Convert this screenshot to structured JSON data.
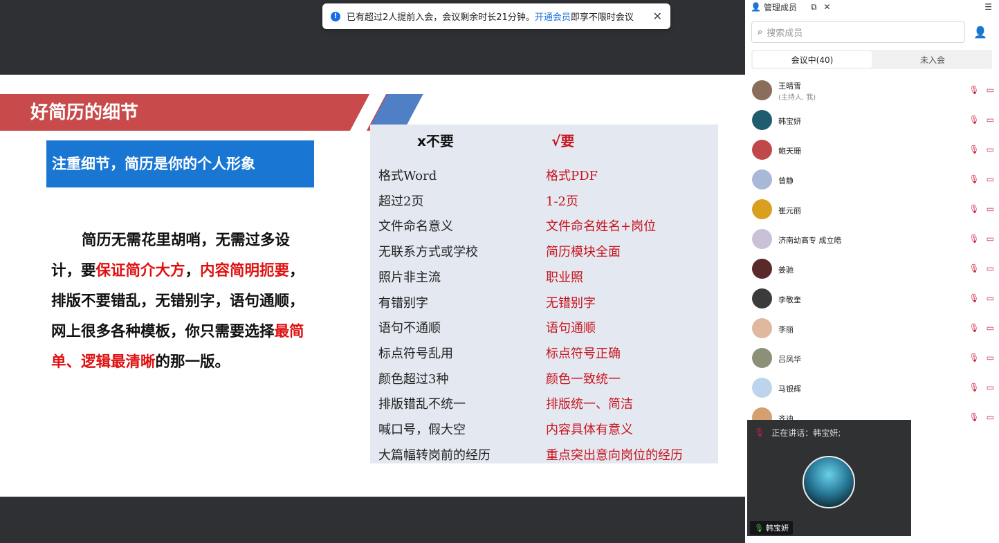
{
  "notice": {
    "text_before": "已有超过2人提前入会，会议剩余时长21分钟。",
    "link": "开通会员",
    "text_after": "即享不限时会议",
    "close": "✕"
  },
  "slide": {
    "title": "好简历的细节",
    "subtitle": "注重细节，简历是你的个人形象",
    "body": {
      "p1": "简历无需花里胡哨，无需过多设计，要",
      "r1": "保证简介大方",
      "p2": "，",
      "r2": "内容简明扼要",
      "p3": "，排版不要错乱，无错别字，语句通顺，网上很多各种模板，你只需要选择",
      "r3": "最简单、逻辑最清晰",
      "p4": "的那一版。"
    },
    "table": {
      "header_bad": "x不要",
      "header_good": "√要",
      "rows": [
        {
          "bad": "格式Word",
          "good": "格式PDF"
        },
        {
          "bad": "超过2页",
          "good": "1-2页"
        },
        {
          "bad": "文件命名意义",
          "good": "文件命名姓名+岗位"
        },
        {
          "bad": "无联系方式或学校",
          "good": "简历模块全面"
        },
        {
          "bad": "照片非主流",
          "good": "职业照"
        },
        {
          "bad": "有错别字",
          "good": "无错别字"
        },
        {
          "bad": "语句不通顺",
          "good": "语句通顺"
        },
        {
          "bad": "标点符号乱用",
          "good": "标点符号正确"
        },
        {
          "bad": "颜色超过3种",
          "good": "颜色一致统一"
        },
        {
          "bad": "排版错乱不统一",
          "good": "排版统一、简洁"
        },
        {
          "bad": "喊口号，假大空",
          "good": "内容具体有意义"
        },
        {
          "bad": "大篇幅转岗前的经历",
          "good": "重点突出意向岗位的经历"
        }
      ]
    }
  },
  "toolbar": {
    "icons": [
      "prev-icon",
      "play-icon",
      "pen-icon",
      "screenshot-icon",
      "camera-icon",
      "more-icon",
      "collapse-icon"
    ],
    "glyphs": [
      "◀",
      "▶",
      "✎",
      "⛶",
      "■",
      "⋯",
      "‹"
    ]
  },
  "panel": {
    "title": "管理成员",
    "search_placeholder": "搜索成员",
    "tab_in": "会议中(40)",
    "tab_out": "未入会",
    "members": [
      {
        "name": "王晴雪",
        "sub": "(主持人, 我)",
        "color": "#8a6d5a"
      },
      {
        "name": "韩宝妍",
        "sub": "",
        "color": "#1f5c6e"
      },
      {
        "name": "鲍天珊",
        "sub": "",
        "color": "#c04848"
      },
      {
        "name": "曾静",
        "sub": "",
        "color": "#a9b8d8"
      },
      {
        "name": "崔元丽",
        "sub": "",
        "color": "#d9a020"
      },
      {
        "name": "济南幼高专 成立皓",
        "sub": "",
        "color": "#c9c2d6"
      },
      {
        "name": "姜驰",
        "sub": "",
        "color": "#5a2a2a"
      },
      {
        "name": "李敬奎",
        "sub": "",
        "color": "#3b3b3b"
      },
      {
        "name": "李丽",
        "sub": "",
        "color": "#e0b8a0"
      },
      {
        "name": "吕凤华",
        "sub": "",
        "color": "#8c9078"
      },
      {
        "name": "马银辉",
        "sub": "",
        "color": "#bcd4ec"
      },
      {
        "name": "齐迪",
        "sub": "",
        "color": "#d4a070"
      }
    ]
  },
  "speaker": {
    "label": "正在讲话：",
    "name": "韩宝妍;",
    "tag": "韩宝妍"
  }
}
